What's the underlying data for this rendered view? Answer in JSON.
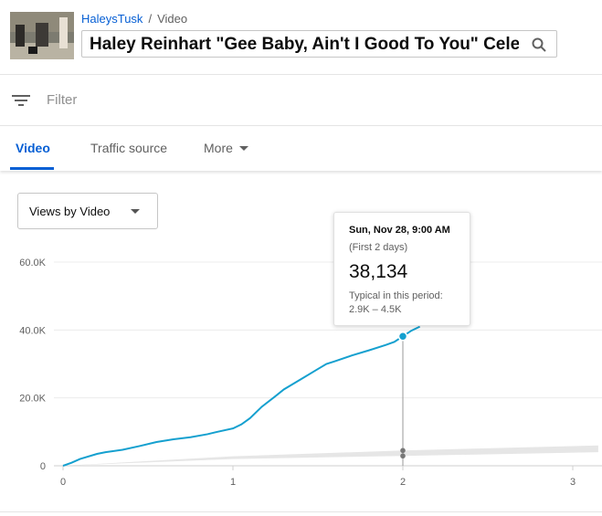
{
  "header": {
    "channel": "HaleysTusk",
    "separator": "/",
    "section": "Video",
    "video_title": "Haley Reinhart \"Gee Baby, Ain't I Good To You\" Cele..."
  },
  "filter": {
    "placeholder": "Filter",
    "icon": "filter-icon"
  },
  "tabs": [
    {
      "label": "Video",
      "active": true
    },
    {
      "label": "Traffic source",
      "active": false
    },
    {
      "label": "More",
      "active": false
    }
  ],
  "metric_selector": {
    "value": "Views by Video"
  },
  "tooltip": {
    "date": "Sun, Nov 28, 9:00 AM",
    "period": "(First 2 days)",
    "value": "38,134",
    "typical_label": "Typical in this period:",
    "typical_range": "2.9K – 4.5K"
  },
  "colors": {
    "accent": "#065fd4",
    "series": "#15a0cf",
    "typical_band": "#e6e6e6"
  },
  "chart_data": {
    "type": "line",
    "ytick_labels": [
      "0",
      "20.0K",
      "40.0K",
      "60.0K"
    ],
    "xtick_labels": [
      "0",
      "1",
      "2",
      "3"
    ],
    "ylim": [
      0,
      65000
    ],
    "xlim": [
      0,
      3.15
    ],
    "grid": true,
    "highlight": {
      "x": 2.0,
      "y": 38134
    },
    "series": [
      {
        "x": [
          0,
          0.05,
          0.1,
          0.2,
          0.25,
          0.35,
          0.45,
          0.55,
          0.65,
          0.75,
          0.85,
          0.9,
          1.0,
          1.05,
          1.1,
          1.17,
          1.25,
          1.3,
          1.4,
          1.5,
          1.55,
          1.6,
          1.7,
          1.8,
          1.9,
          1.95,
          2.0,
          2.05,
          2.1
        ],
        "y": [
          0,
          900,
          2000,
          3500,
          4000,
          4700,
          5800,
          7000,
          7800,
          8400,
          9300,
          9900,
          11000,
          12200,
          14000,
          17400,
          20500,
          22500,
          25500,
          28500,
          30000,
          30800,
          32500,
          34000,
          35600,
          36500,
          38134,
          39800,
          41000
        ]
      }
    ],
    "typical_band": {
      "x": [
        0,
        1,
        2,
        3.15
      ],
      "low": [
        0,
        2000,
        2900,
        4000
      ],
      "high": [
        0,
        2800,
        4500,
        6000
      ]
    }
  }
}
